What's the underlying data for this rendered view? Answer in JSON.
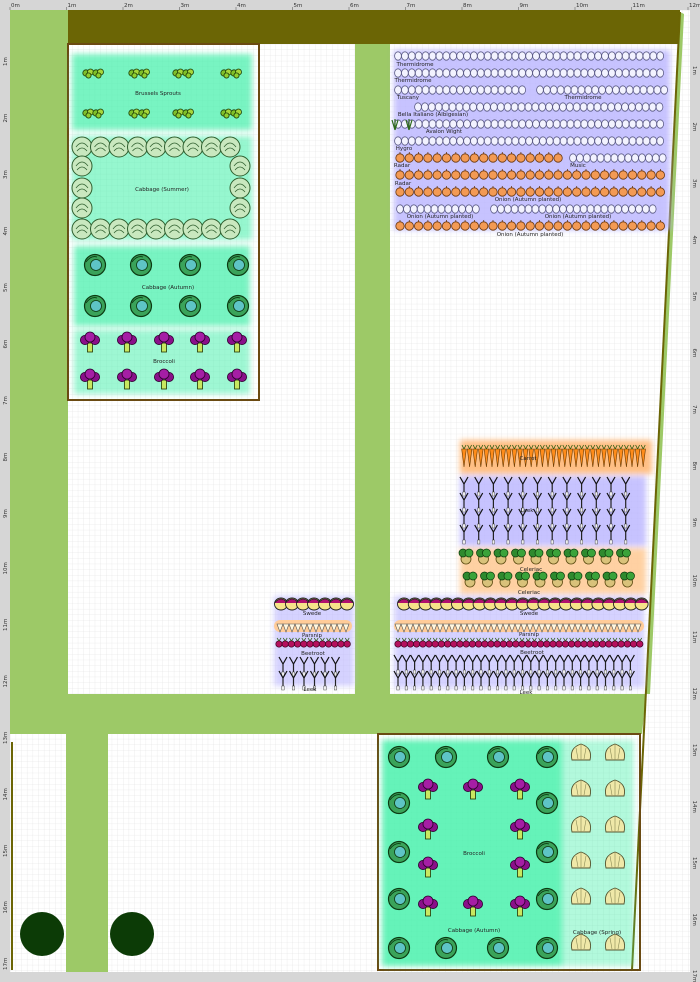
{
  "ruler": {
    "top": [
      "0m",
      "1m",
      "2m",
      "3m",
      "4m",
      "5m",
      "6m",
      "7m",
      "8m",
      "9m",
      "10m",
      "11m",
      "12m"
    ],
    "left": [
      "1m",
      "2m",
      "3m",
      "4m",
      "5m",
      "6m",
      "7m",
      "8m",
      "9m",
      "10m",
      "11m",
      "12m",
      "13m",
      "14m",
      "15m",
      "16m",
      "17m"
    ]
  },
  "colors": {
    "path": "#9dc967",
    "hedge": "#6b6505",
    "bed_border": "#6b4a12",
    "ruler_bg": "#d6d6d6",
    "grid": "#d9d9d9",
    "tree": "#0c3b06"
  },
  "labels": {
    "brussels": "Brussels Sprouts",
    "cabbage_summer": "Cabbage (Summer)",
    "cabbage_autumn_top": "Cabbage (Autumn)",
    "broccoli_top": "Broccoli",
    "thermidrome_1": "Thermidrome",
    "thermidrome_2": "Thermidrome",
    "thermidrome_3": "Thermidrome",
    "tuscany": "Tuscany",
    "bella_italiano": "Bella Italiano (Albigesian)",
    "avalon_wight": "Avalon Wight",
    "hygro": "Hygro",
    "radar_1": "Radar",
    "music": "Music",
    "radar_2": "Radar",
    "onion_autumn_1": "Onion (Autumn planted)",
    "onion_autumn_2": "Onion (Autumn planted)",
    "onion_autumn_3": "Onion (Autumn planted)",
    "onion_autumn_4": "Onion (Autumn planted)",
    "carrot": "Carrot",
    "leek_big": "Leek",
    "celeriac_1": "Celeriac",
    "celeriac_2": "Celeriac",
    "swede_small": "Swede",
    "parsnip_small": "Parsnip",
    "beetroot_small": "Beetroot",
    "leek_small": "Leek",
    "swede_big": "Swede",
    "parsnip_big": "Parsnip",
    "beetroot_big": "Beetroot",
    "leek_bottom": "Leek",
    "broccoli_bottom": "Broccoli",
    "cabbage_autumn_bottom": "Cabbage (Autumn)",
    "cabbage_spring": "Cabbage (Spring)"
  }
}
